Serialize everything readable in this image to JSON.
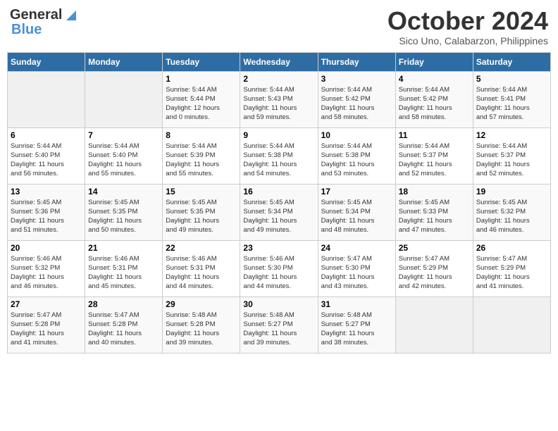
{
  "logo": {
    "line1": "General",
    "line2": "Blue"
  },
  "title": "October 2024",
  "subtitle": "Sico Uno, Calabarzon, Philippines",
  "days_of_week": [
    "Sunday",
    "Monday",
    "Tuesday",
    "Wednesday",
    "Thursday",
    "Friday",
    "Saturday"
  ],
  "weeks": [
    [
      {
        "day": "",
        "info": ""
      },
      {
        "day": "",
        "info": ""
      },
      {
        "day": "1",
        "info": "Sunrise: 5:44 AM\nSunset: 5:44 PM\nDaylight: 12 hours\nand 0 minutes."
      },
      {
        "day": "2",
        "info": "Sunrise: 5:44 AM\nSunset: 5:43 PM\nDaylight: 11 hours\nand 59 minutes."
      },
      {
        "day": "3",
        "info": "Sunrise: 5:44 AM\nSunset: 5:42 PM\nDaylight: 11 hours\nand 58 minutes."
      },
      {
        "day": "4",
        "info": "Sunrise: 5:44 AM\nSunset: 5:42 PM\nDaylight: 11 hours\nand 58 minutes."
      },
      {
        "day": "5",
        "info": "Sunrise: 5:44 AM\nSunset: 5:41 PM\nDaylight: 11 hours\nand 57 minutes."
      }
    ],
    [
      {
        "day": "6",
        "info": "Sunrise: 5:44 AM\nSunset: 5:40 PM\nDaylight: 11 hours\nand 56 minutes."
      },
      {
        "day": "7",
        "info": "Sunrise: 5:44 AM\nSunset: 5:40 PM\nDaylight: 11 hours\nand 55 minutes."
      },
      {
        "day": "8",
        "info": "Sunrise: 5:44 AM\nSunset: 5:39 PM\nDaylight: 11 hours\nand 55 minutes."
      },
      {
        "day": "9",
        "info": "Sunrise: 5:44 AM\nSunset: 5:38 PM\nDaylight: 11 hours\nand 54 minutes."
      },
      {
        "day": "10",
        "info": "Sunrise: 5:44 AM\nSunset: 5:38 PM\nDaylight: 11 hours\nand 53 minutes."
      },
      {
        "day": "11",
        "info": "Sunrise: 5:44 AM\nSunset: 5:37 PM\nDaylight: 11 hours\nand 52 minutes."
      },
      {
        "day": "12",
        "info": "Sunrise: 5:44 AM\nSunset: 5:37 PM\nDaylight: 11 hours\nand 52 minutes."
      }
    ],
    [
      {
        "day": "13",
        "info": "Sunrise: 5:45 AM\nSunset: 5:36 PM\nDaylight: 11 hours\nand 51 minutes."
      },
      {
        "day": "14",
        "info": "Sunrise: 5:45 AM\nSunset: 5:35 PM\nDaylight: 11 hours\nand 50 minutes."
      },
      {
        "day": "15",
        "info": "Sunrise: 5:45 AM\nSunset: 5:35 PM\nDaylight: 11 hours\nand 49 minutes."
      },
      {
        "day": "16",
        "info": "Sunrise: 5:45 AM\nSunset: 5:34 PM\nDaylight: 11 hours\nand 49 minutes."
      },
      {
        "day": "17",
        "info": "Sunrise: 5:45 AM\nSunset: 5:34 PM\nDaylight: 11 hours\nand 48 minutes."
      },
      {
        "day": "18",
        "info": "Sunrise: 5:45 AM\nSunset: 5:33 PM\nDaylight: 11 hours\nand 47 minutes."
      },
      {
        "day": "19",
        "info": "Sunrise: 5:45 AM\nSunset: 5:32 PM\nDaylight: 11 hours\nand 46 minutes."
      }
    ],
    [
      {
        "day": "20",
        "info": "Sunrise: 5:46 AM\nSunset: 5:32 PM\nDaylight: 11 hours\nand 46 minutes."
      },
      {
        "day": "21",
        "info": "Sunrise: 5:46 AM\nSunset: 5:31 PM\nDaylight: 11 hours\nand 45 minutes."
      },
      {
        "day": "22",
        "info": "Sunrise: 5:46 AM\nSunset: 5:31 PM\nDaylight: 11 hours\nand 44 minutes."
      },
      {
        "day": "23",
        "info": "Sunrise: 5:46 AM\nSunset: 5:30 PM\nDaylight: 11 hours\nand 44 minutes."
      },
      {
        "day": "24",
        "info": "Sunrise: 5:47 AM\nSunset: 5:30 PM\nDaylight: 11 hours\nand 43 minutes."
      },
      {
        "day": "25",
        "info": "Sunrise: 5:47 AM\nSunset: 5:29 PM\nDaylight: 11 hours\nand 42 minutes."
      },
      {
        "day": "26",
        "info": "Sunrise: 5:47 AM\nSunset: 5:29 PM\nDaylight: 11 hours\nand 41 minutes."
      }
    ],
    [
      {
        "day": "27",
        "info": "Sunrise: 5:47 AM\nSunset: 5:28 PM\nDaylight: 11 hours\nand 41 minutes."
      },
      {
        "day": "28",
        "info": "Sunrise: 5:47 AM\nSunset: 5:28 PM\nDaylight: 11 hours\nand 40 minutes."
      },
      {
        "day": "29",
        "info": "Sunrise: 5:48 AM\nSunset: 5:28 PM\nDaylight: 11 hours\nand 39 minutes."
      },
      {
        "day": "30",
        "info": "Sunrise: 5:48 AM\nSunset: 5:27 PM\nDaylight: 11 hours\nand 39 minutes."
      },
      {
        "day": "31",
        "info": "Sunrise: 5:48 AM\nSunset: 5:27 PM\nDaylight: 11 hours\nand 38 minutes."
      },
      {
        "day": "",
        "info": ""
      },
      {
        "day": "",
        "info": ""
      }
    ]
  ]
}
